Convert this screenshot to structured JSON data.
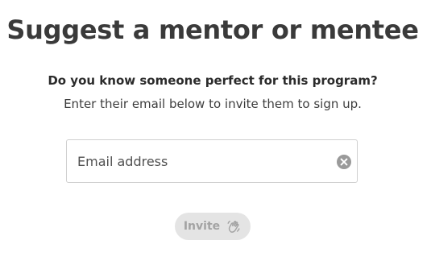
{
  "page": {
    "title": "Suggest a mentor or mentee",
    "question": "Do you know someone perfect for this program?",
    "instruction": "Enter their email below to invite them to sign up."
  },
  "email": {
    "placeholder": "Email address",
    "value": "",
    "clear_icon": "clear-circle-icon"
  },
  "invite": {
    "label": "Invite",
    "icon": "waving-hand-icon",
    "state": "disabled"
  },
  "colors": {
    "title": "#3a3a3a",
    "button_bg": "#e4e4e4",
    "button_text": "#a3a3a3",
    "clear_icon": "#9a9a9a"
  }
}
